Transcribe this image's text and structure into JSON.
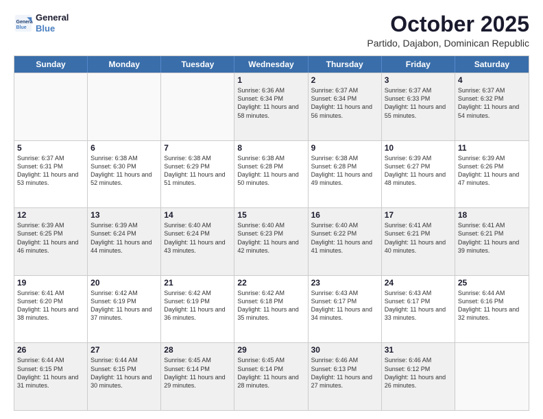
{
  "logo": {
    "line1": "General",
    "line2": "Blue"
  },
  "header": {
    "month_title": "October 2025",
    "subtitle": "Partido, Dajabon, Dominican Republic"
  },
  "weekdays": [
    "Sunday",
    "Monday",
    "Tuesday",
    "Wednesday",
    "Thursday",
    "Friday",
    "Saturday"
  ],
  "rows": [
    [
      {
        "day": "",
        "info": ""
      },
      {
        "day": "",
        "info": ""
      },
      {
        "day": "",
        "info": ""
      },
      {
        "day": "1",
        "info": "Sunrise: 6:36 AM\nSunset: 6:34 PM\nDaylight: 11 hours\nand 58 minutes."
      },
      {
        "day": "2",
        "info": "Sunrise: 6:37 AM\nSunset: 6:34 PM\nDaylight: 11 hours\nand 56 minutes."
      },
      {
        "day": "3",
        "info": "Sunrise: 6:37 AM\nSunset: 6:33 PM\nDaylight: 11 hours\nand 55 minutes."
      },
      {
        "day": "4",
        "info": "Sunrise: 6:37 AM\nSunset: 6:32 PM\nDaylight: 11 hours\nand 54 minutes."
      }
    ],
    [
      {
        "day": "5",
        "info": "Sunrise: 6:37 AM\nSunset: 6:31 PM\nDaylight: 11 hours\nand 53 minutes."
      },
      {
        "day": "6",
        "info": "Sunrise: 6:38 AM\nSunset: 6:30 PM\nDaylight: 11 hours\nand 52 minutes."
      },
      {
        "day": "7",
        "info": "Sunrise: 6:38 AM\nSunset: 6:29 PM\nDaylight: 11 hours\nand 51 minutes."
      },
      {
        "day": "8",
        "info": "Sunrise: 6:38 AM\nSunset: 6:28 PM\nDaylight: 11 hours\nand 50 minutes."
      },
      {
        "day": "9",
        "info": "Sunrise: 6:38 AM\nSunset: 6:28 PM\nDaylight: 11 hours\nand 49 minutes."
      },
      {
        "day": "10",
        "info": "Sunrise: 6:39 AM\nSunset: 6:27 PM\nDaylight: 11 hours\nand 48 minutes."
      },
      {
        "day": "11",
        "info": "Sunrise: 6:39 AM\nSunset: 6:26 PM\nDaylight: 11 hours\nand 47 minutes."
      }
    ],
    [
      {
        "day": "12",
        "info": "Sunrise: 6:39 AM\nSunset: 6:25 PM\nDaylight: 11 hours\nand 46 minutes."
      },
      {
        "day": "13",
        "info": "Sunrise: 6:39 AM\nSunset: 6:24 PM\nDaylight: 11 hours\nand 44 minutes."
      },
      {
        "day": "14",
        "info": "Sunrise: 6:40 AM\nSunset: 6:24 PM\nDaylight: 11 hours\nand 43 minutes."
      },
      {
        "day": "15",
        "info": "Sunrise: 6:40 AM\nSunset: 6:23 PM\nDaylight: 11 hours\nand 42 minutes."
      },
      {
        "day": "16",
        "info": "Sunrise: 6:40 AM\nSunset: 6:22 PM\nDaylight: 11 hours\nand 41 minutes."
      },
      {
        "day": "17",
        "info": "Sunrise: 6:41 AM\nSunset: 6:21 PM\nDaylight: 11 hours\nand 40 minutes."
      },
      {
        "day": "18",
        "info": "Sunrise: 6:41 AM\nSunset: 6:21 PM\nDaylight: 11 hours\nand 39 minutes."
      }
    ],
    [
      {
        "day": "19",
        "info": "Sunrise: 6:41 AM\nSunset: 6:20 PM\nDaylight: 11 hours\nand 38 minutes."
      },
      {
        "day": "20",
        "info": "Sunrise: 6:42 AM\nSunset: 6:19 PM\nDaylight: 11 hours\nand 37 minutes."
      },
      {
        "day": "21",
        "info": "Sunrise: 6:42 AM\nSunset: 6:19 PM\nDaylight: 11 hours\nand 36 minutes."
      },
      {
        "day": "22",
        "info": "Sunrise: 6:42 AM\nSunset: 6:18 PM\nDaylight: 11 hours\nand 35 minutes."
      },
      {
        "day": "23",
        "info": "Sunrise: 6:43 AM\nSunset: 6:17 PM\nDaylight: 11 hours\nand 34 minutes."
      },
      {
        "day": "24",
        "info": "Sunrise: 6:43 AM\nSunset: 6:17 PM\nDaylight: 11 hours\nand 33 minutes."
      },
      {
        "day": "25",
        "info": "Sunrise: 6:44 AM\nSunset: 6:16 PM\nDaylight: 11 hours\nand 32 minutes."
      }
    ],
    [
      {
        "day": "26",
        "info": "Sunrise: 6:44 AM\nSunset: 6:15 PM\nDaylight: 11 hours\nand 31 minutes."
      },
      {
        "day": "27",
        "info": "Sunrise: 6:44 AM\nSunset: 6:15 PM\nDaylight: 11 hours\nand 30 minutes."
      },
      {
        "day": "28",
        "info": "Sunrise: 6:45 AM\nSunset: 6:14 PM\nDaylight: 11 hours\nand 29 minutes."
      },
      {
        "day": "29",
        "info": "Sunrise: 6:45 AM\nSunset: 6:14 PM\nDaylight: 11 hours\nand 28 minutes."
      },
      {
        "day": "30",
        "info": "Sunrise: 6:46 AM\nSunset: 6:13 PM\nDaylight: 11 hours\nand 27 minutes."
      },
      {
        "day": "31",
        "info": "Sunrise: 6:46 AM\nSunset: 6:12 PM\nDaylight: 11 hours\nand 26 minutes."
      },
      {
        "day": "",
        "info": ""
      }
    ]
  ]
}
